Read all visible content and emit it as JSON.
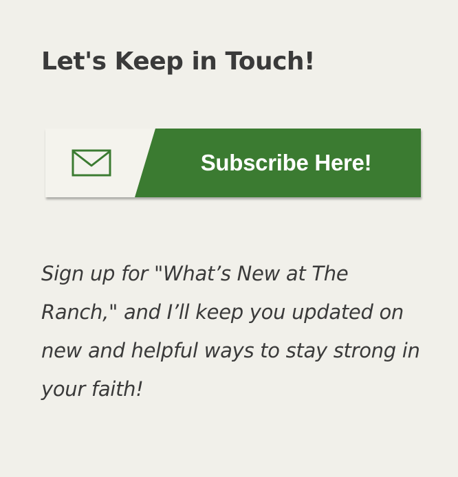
{
  "widget": {
    "title": "Let's Keep in Touch!",
    "subscribe_label": "Subscribe Here!",
    "subscribe_icon": "envelope-icon",
    "blurb": "Sign up for \"What’s New at The Ranch,\" and I’ll keep you updated on new and helpful ways to stay strong in your faith!"
  },
  "colors": {
    "background": "#f1f0ea",
    "button_green": "#3b7b31",
    "icon_panel": "#f4f3ed",
    "text": "#3a3a3a"
  }
}
